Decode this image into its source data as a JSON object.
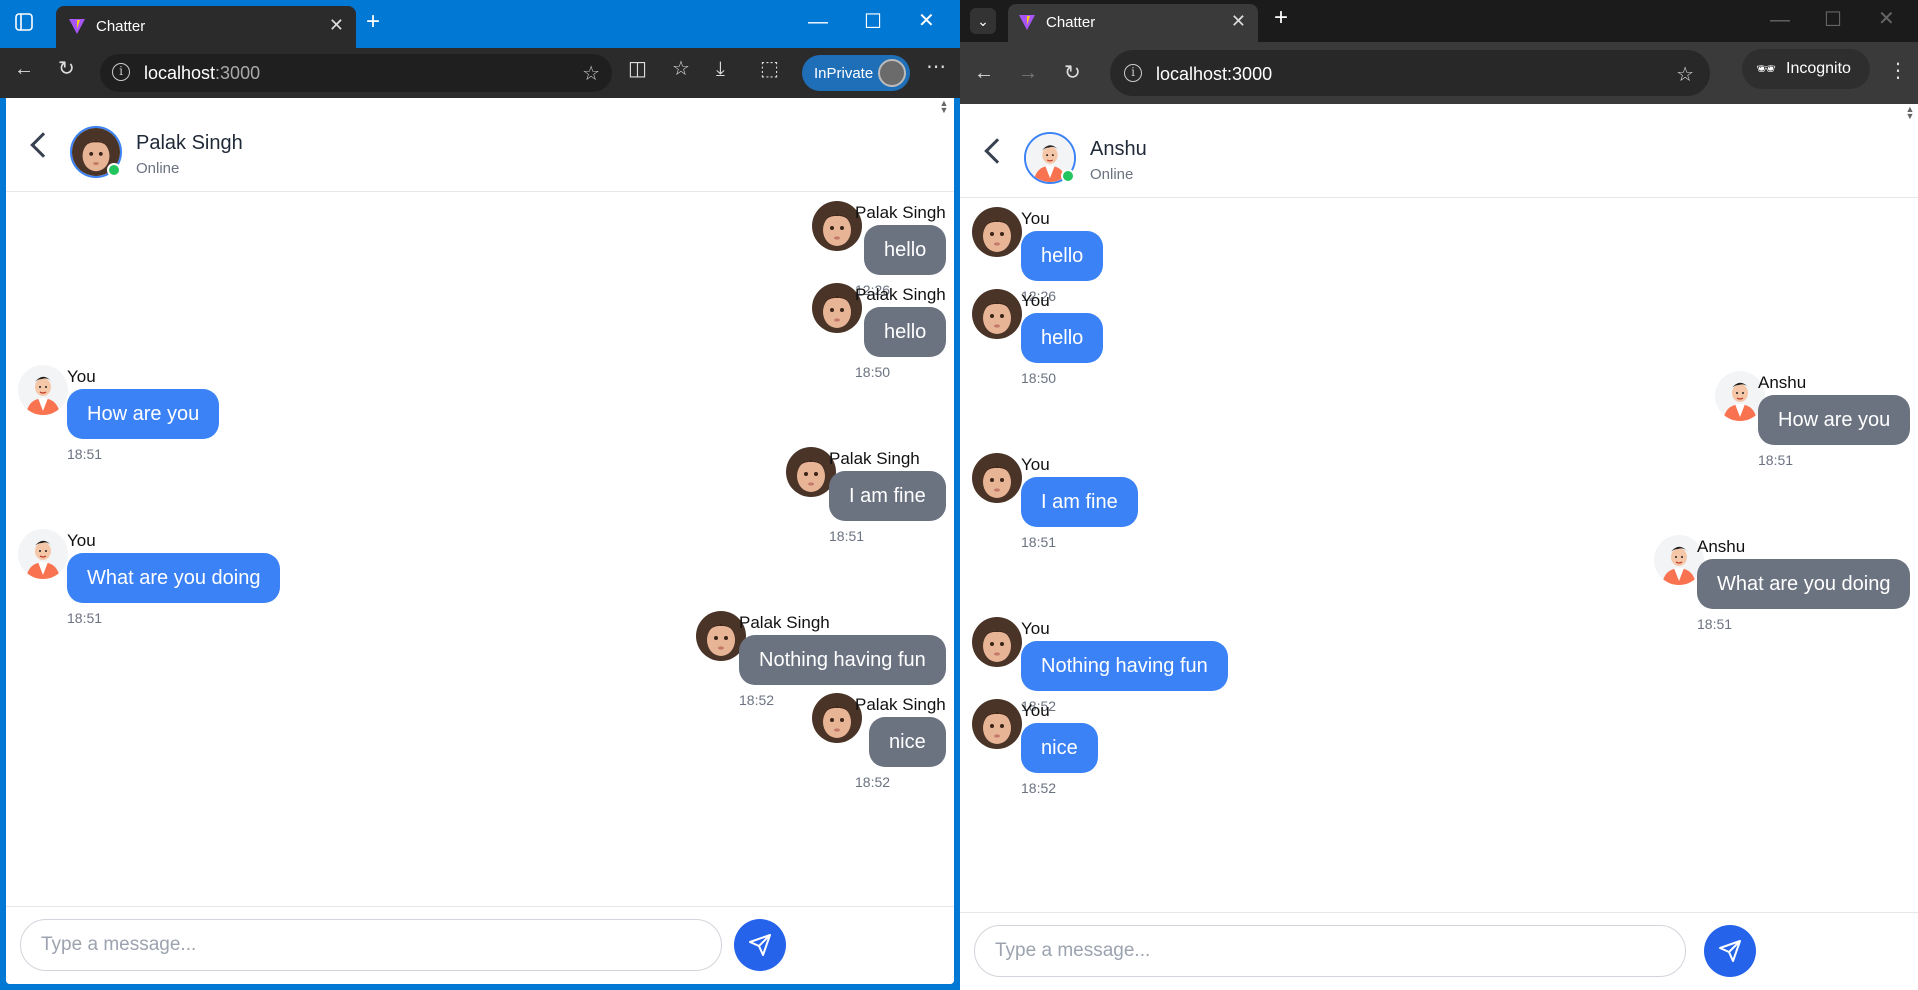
{
  "left_window": {
    "tab_title": "Chatter",
    "url_host": "localhost",
    "url_port": ":3000",
    "inprivate_label": "InPrivate",
    "chat": {
      "contact_name": "Palak Singh",
      "contact_status": "Online",
      "input_placeholder": "Type a message...",
      "messages": [
        {
          "side": "right",
          "sender": "Palak Singh",
          "text": "hello",
          "time": "12:26"
        },
        {
          "side": "right",
          "sender": "Palak Singh",
          "text": "hello",
          "time": "18:50"
        },
        {
          "side": "left",
          "sender": "You",
          "text": "How are you",
          "time": "18:51"
        },
        {
          "side": "right",
          "sender": "Palak Singh",
          "text": "I am fine",
          "time": "18:51"
        },
        {
          "side": "left",
          "sender": "You",
          "text": "What are you doing",
          "time": "18:51"
        },
        {
          "side": "right",
          "sender": "Palak Singh",
          "text": "Nothing having fun",
          "time": "18:52"
        },
        {
          "side": "right",
          "sender": "Palak Singh",
          "text": "nice",
          "time": "18:52"
        }
      ]
    }
  },
  "right_window": {
    "tab_title": "Chatter",
    "url": "localhost:3000",
    "incognito_label": "Incognito",
    "chat": {
      "contact_name": "Anshu",
      "contact_status": "Online",
      "input_placeholder": "Type a message...",
      "messages": [
        {
          "side": "left",
          "sender": "You",
          "text": "hello",
          "time": "12:26"
        },
        {
          "side": "left",
          "sender": "You",
          "text": "hello",
          "time": "18:50"
        },
        {
          "side": "right",
          "sender": "Anshu",
          "text": "How are you",
          "time": "18:51"
        },
        {
          "side": "left",
          "sender": "You",
          "text": "I am fine",
          "time": "18:51"
        },
        {
          "side": "right",
          "sender": "Anshu",
          "text": "What are you doing",
          "time": "18:51"
        },
        {
          "side": "left",
          "sender": "You",
          "text": "Nothing having fun",
          "time": "18:52"
        },
        {
          "side": "left",
          "sender": "You",
          "text": "nice",
          "time": "18:52"
        }
      ]
    }
  },
  "colors": {
    "outgoing_bubble": "#3b82f6",
    "incoming_bubble": "#6b7280",
    "send_button": "#2563eb",
    "online": "#22c55e",
    "edge_accent": "#0078d4"
  },
  "icons": {
    "favicon": "vite-logo-icon",
    "back": "chevron-left-icon",
    "send": "paper-plane-icon"
  }
}
